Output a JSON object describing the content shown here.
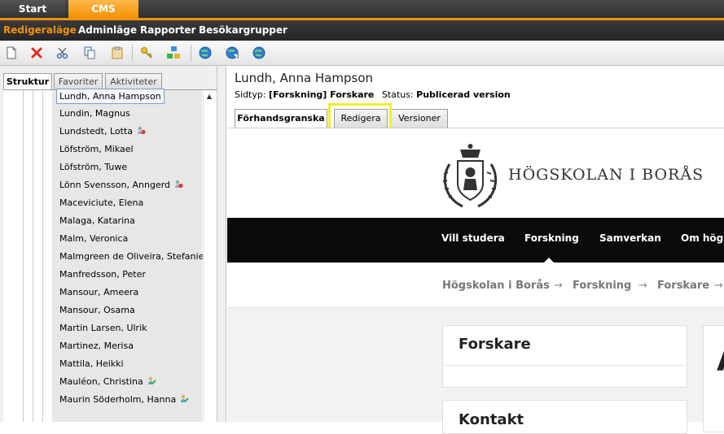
{
  "top_tabs": {
    "start": "Start",
    "cms": "CMS"
  },
  "menu": {
    "edit_mode": "Redigeraläge",
    "admin_mode": "Adminläge",
    "reports": "Rapporter",
    "visitor_groups": "Besökargrupper"
  },
  "toolbar": {
    "icons": [
      "new-page-icon",
      "delete-icon",
      "cut-icon",
      "copy-icon",
      "paste-icon",
      "key-icon",
      "structure-icon",
      "globe-back-icon",
      "globe-refresh-icon",
      "globe-icon"
    ]
  },
  "left_tabs": {
    "structure": "Struktur",
    "favorites": "Favoriter",
    "activities": "Aktiviteter"
  },
  "tree": {
    "items": [
      {
        "label": "Lundh, Anna Hampson",
        "selected": true,
        "icon": ""
      },
      {
        "label": "Lundin, Magnus",
        "icon": ""
      },
      {
        "label": "Lundstedt, Lotta",
        "icon": "person-red-icon"
      },
      {
        "label": "Löfström, Mikael",
        "icon": ""
      },
      {
        "label": "Löfström, Tuwe",
        "icon": ""
      },
      {
        "label": "Lönn Svensson, Anngerd",
        "icon": "person-red-icon"
      },
      {
        "label": "Maceviciute, Elena",
        "icon": ""
      },
      {
        "label": "Malaga, Katarina",
        "icon": ""
      },
      {
        "label": "Malm, Veronica",
        "icon": ""
      },
      {
        "label": "Malmgreen de Oliveira, Stefanie",
        "icon": ""
      },
      {
        "label": "Manfredsson, Peter",
        "icon": ""
      },
      {
        "label": "Mansour, Ameera",
        "icon": ""
      },
      {
        "label": "Mansour, Osama",
        "icon": ""
      },
      {
        "label": "Martin Larsen, Ulrik",
        "icon": ""
      },
      {
        "label": "Martinez, Merisa",
        "icon": ""
      },
      {
        "label": "Mattila, Heikki",
        "icon": ""
      },
      {
        "label": "Mauléon, Christina",
        "icon": "person-edit-icon"
      },
      {
        "label": "Maurin Söderholm, Hanna",
        "icon": "person-edit-icon"
      }
    ]
  },
  "page": {
    "title": "Lundh, Anna Hampson",
    "type_label": "Sidtyp:",
    "type_value": "[Forskning] Forskare",
    "status_label": "Status:",
    "status_value": "Publicerad version"
  },
  "right_tabs": {
    "preview": "Förhandsgranska",
    "edit": "Redigera",
    "versions": "Versioner"
  },
  "site": {
    "name": "HÖGSKOLAN I BORÅS",
    "nav": [
      "Vill studera",
      "Forskning",
      "Samverkan",
      "Om högs"
    ],
    "breadcrumb": [
      "Högskolan i Borås",
      "Forskning",
      "Forskare"
    ],
    "breadcrumb_sep": "→",
    "card_forskare": "Forskare",
    "card_kontakt": "Kontakt",
    "right_card_glyph": "A"
  },
  "colors": {
    "accent": "#f39200",
    "highlight": "#f4ef2e",
    "nav_bg": "#0b0b0b"
  }
}
